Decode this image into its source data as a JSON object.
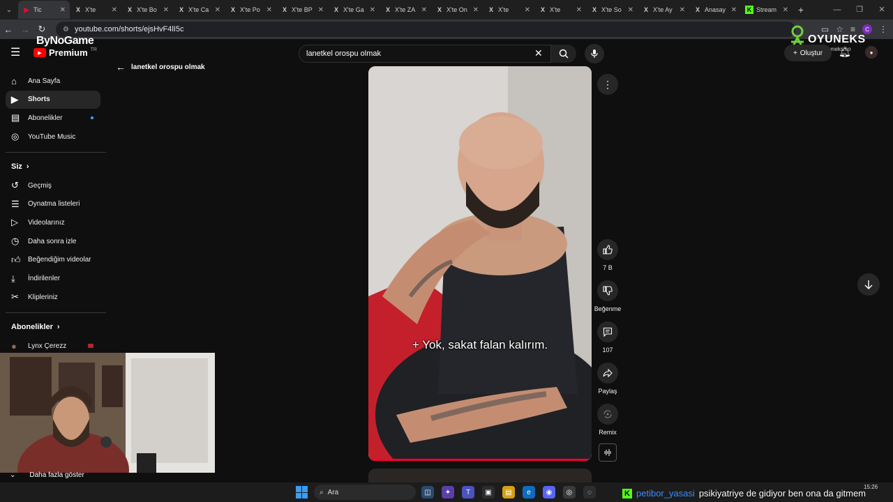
{
  "browser": {
    "tabs": [
      {
        "title": "Tic",
        "icon": "youtube-icon",
        "active": true
      },
      {
        "title": "X'te",
        "icon": "x-icon"
      },
      {
        "title": "X'te Bo",
        "icon": "x-icon"
      },
      {
        "title": "X'te Ca",
        "icon": "x-icon"
      },
      {
        "title": "X'te Po",
        "icon": "x-icon"
      },
      {
        "title": "X'te BP",
        "icon": "x-icon"
      },
      {
        "title": "X'te Ga",
        "icon": "x-icon"
      },
      {
        "title": "X'te ZA",
        "icon": "x-icon"
      },
      {
        "title": "X'te On",
        "icon": "x-icon"
      },
      {
        "title": "X'te",
        "icon": "x-icon"
      },
      {
        "title": "X'te",
        "icon": "x-icon"
      },
      {
        "title": "X'te So",
        "icon": "x-icon"
      },
      {
        "title": "X'te Ay",
        "icon": "x-icon"
      },
      {
        "title": "Anasay",
        "icon": "x-icon"
      },
      {
        "title": "Stream",
        "icon": "kick-icon"
      }
    ],
    "url": "youtube.com/shorts/ejsHvF4lI5c",
    "profile_initial": "C"
  },
  "youtube": {
    "brand": "Premium",
    "region": "TR",
    "search_query": "lanetkel orospu olmak",
    "back_label": "lanetkel orospu olmak",
    "create_label": "Oluştur"
  },
  "overlays": {
    "bynogame": "ByNoGame",
    "oyuneks_name": "OYUNEKS",
    "oyuneks_url": "www.oyuneks.co"
  },
  "sidebar": {
    "main": [
      {
        "label": "Ana Sayfa",
        "icon": "home-icon"
      },
      {
        "label": "Shorts",
        "icon": "shorts-icon",
        "active": true
      },
      {
        "label": "Abonelikler",
        "icon": "subscriptions-icon",
        "dot": true
      },
      {
        "label": "YouTube Music",
        "icon": "music-icon"
      }
    ],
    "you_heading": "Siz",
    "you": [
      {
        "label": "Geçmiş",
        "icon": "history-icon"
      },
      {
        "label": "Oynatma listeleri",
        "icon": "playlists-icon"
      },
      {
        "label": "Videolarınız",
        "icon": "your-videos-icon"
      },
      {
        "label": "Daha sonra izle",
        "icon": "watch-later-icon"
      },
      {
        "label": "Beğendiğim videolar",
        "icon": "liked-icon"
      },
      {
        "label": "İndirilenler",
        "icon": "downloads-icon"
      },
      {
        "label": "Klipleriniz",
        "icon": "clips-icon"
      }
    ],
    "subs_heading": "Abonelikler",
    "subs": [
      {
        "label": "Lynx Çerezz",
        "live": true
      }
    ],
    "show_more": "Daha fazla göster"
  },
  "short": {
    "caption": "+ Yok, sakat falan kalırım.",
    "actions": {
      "like_count": "7 B",
      "dislike_label": "Beğenme",
      "comment_count": "107",
      "share_label": "Paylaş",
      "remix_label": "Remix"
    }
  },
  "taskbar": {
    "search_placeholder": "Ara",
    "time": "15:26"
  },
  "chat": {
    "user": "petibor_yasasi",
    "message": "psikiyatriye de gidiyor ben ona da gitmem"
  },
  "colors": {
    "accent_red": "#ff0033",
    "kick_green": "#53fc18",
    "background": "#0f0f0f"
  }
}
